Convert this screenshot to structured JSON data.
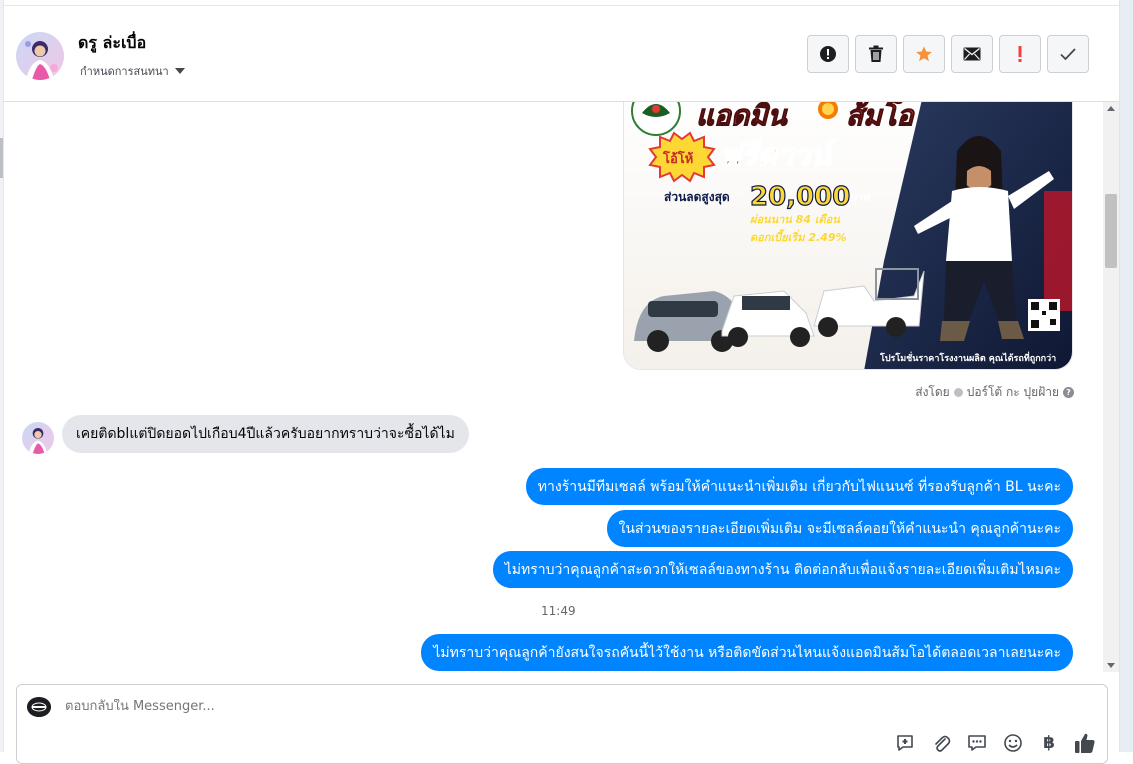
{
  "header": {
    "contact_name": "ดรู ล่ะเบื่อ",
    "label_menu": "กำหนดการสนทนา",
    "actions": [
      {
        "name": "mark-spam",
        "icon": "exclamation-circle-icon"
      },
      {
        "name": "delete",
        "icon": "trash-icon"
      },
      {
        "name": "star",
        "icon": "star-icon",
        "color": "#f7923b"
      },
      {
        "name": "mark-unread",
        "icon": "envelope-icon"
      },
      {
        "name": "important",
        "icon": "exclamation-icon",
        "color": "#fa3e3e"
      },
      {
        "name": "mark-done",
        "icon": "check-icon"
      }
    ]
  },
  "promo": {
    "headline_1": "แอดมิน",
    "headline_2": "ส้มโอ",
    "badge": "โอ้โห้",
    "offer": "ฟรีดาวน์",
    "discount_label": "ส่วนลดสูงสุด",
    "discount_amount": "20,000",
    "currency": "บาท",
    "installment": "ผ่อนนาน 84 เดือน",
    "interest": "ดอกเบี้ยเริ่ม 2.49%",
    "footer": "โปรโมชั่นราคาโรงงานผลิต คุณได้รถที่ถูกกว่า"
  },
  "conversation": {
    "sent_by_prefix": "ส่งโดย",
    "sent_by_name": "ปอร์โต้ กะ ปุยฝ้าย",
    "help_glyph": "?",
    "incoming": "เคยติดblแต่ปิดยอดไปเกือบ4ปีแล้วครับอยากทราบว่าจะซื้อได้ไม",
    "outgoing": [
      "ทางร้านมีทีมเซลล์ พร้อมให้คำแนะนำเพิ่มเติม เกี่ยวกับไฟแนนซ์ ที่รองรับลูกค้า BL นะคะ",
      "ในส่วนของรายละเอียดเพิ่มเติม จะมีเซลล์คอยให้คำแนะนำ คุณลูกค้านะคะ",
      "ไม่ทราบว่าคุณลูกค้าสะดวกให้เซลล์ของทางร้าน ติดต่อกลับเพื่อแจ้งรายละเอียดเพิ่มเติมไหมคะ"
    ],
    "timestamp": "11:49",
    "last_outgoing": "ไม่ทราบว่าคุณลูกค้ายังสนใจรถคันนี้ไว้ใช้งาน หรือติดขัดส่วนไหนแจ้งแอดมินส้มโอได้ตลอดเวลาเลยนะคะ"
  },
  "composer": {
    "placeholder": "ตอบกลับใน Messenger...",
    "baht_glyph": "฿",
    "tools": [
      "saved-reply-icon",
      "attachment-icon",
      "chat-icon",
      "emoji-icon",
      "baht-icon",
      "thumbs-up-icon"
    ]
  }
}
